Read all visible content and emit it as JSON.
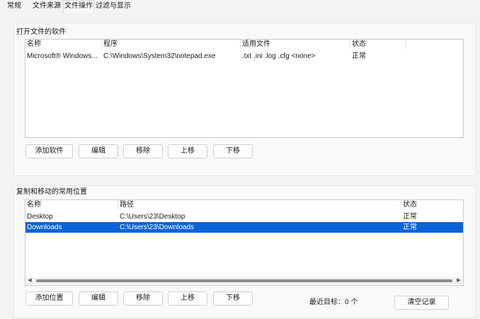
{
  "tabs": [
    {
      "label": "常规",
      "active": false
    },
    {
      "label": "文件来源",
      "active": false
    },
    {
      "label": "文件操作",
      "active": true
    },
    {
      "label": "过滤与显示",
      "active": false
    }
  ],
  "open_with": {
    "title": "打开文件的软件",
    "columns": [
      "名称",
      "程序",
      "适用文件",
      "状态"
    ],
    "rows": [
      {
        "name": "Microsoft® Windows...",
        "program": "C:\\Windows\\System32\\notepad.exe",
        "files": ".txt .ini .log .cfg <none>",
        "status": "正常"
      }
    ],
    "buttons": {
      "add": "添加软件",
      "edit": "编辑",
      "remove": "移除",
      "up": "上移",
      "down": "下移"
    }
  },
  "locations": {
    "title": "复制和移动的常用位置",
    "columns": [
      "名称",
      "路径",
      "状态"
    ],
    "rows": [
      {
        "name": "Desktop",
        "path": "C:\\Users\\23\\Desktop",
        "status": "正常",
        "selected": false
      },
      {
        "name": "Downloads",
        "path": "C:\\Users\\23\\Downloads",
        "status": "正常",
        "selected": true
      }
    ],
    "buttons": {
      "add": "添加位置",
      "edit": "编辑",
      "remove": "移除",
      "up": "上移",
      "down": "下移",
      "clear": "清空记录"
    },
    "recent_label": "最近目标：",
    "recent_count": "0 个",
    "scroll_left_icon": "triangle-left-icon",
    "scroll_right_icon": "triangle-right-icon"
  },
  "colors": {
    "selection": "#0a64d7",
    "window_bg": "#f3f3f3",
    "list_bg": "#ffffff"
  }
}
